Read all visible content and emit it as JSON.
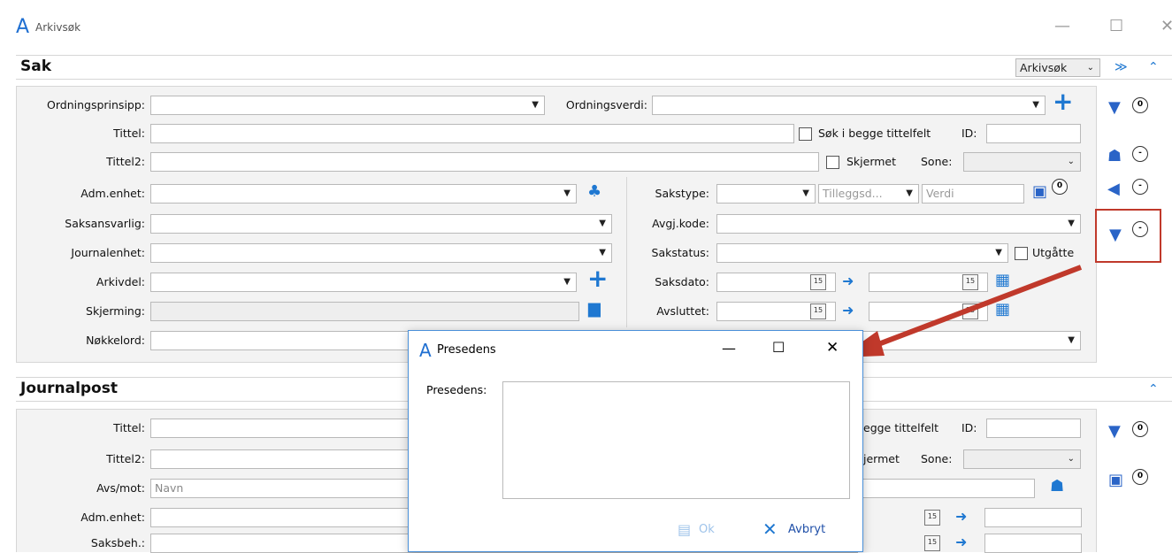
{
  "window": {
    "title": "Arkivsøk",
    "logo": "A",
    "minimize": "—",
    "maximize": "☐",
    "close": "✕"
  },
  "sak": {
    "title": "Sak",
    "search_type": "Arkivsøk",
    "collapse_all": "≫",
    "collapse": "⌃",
    "labels": {
      "ordningsprinsipp": "Ordningsprinsipp:",
      "ordningsverdi": "Ordningsverdi:",
      "tittel": "Tittel:",
      "tittel2": "Tittel2:",
      "admenhet": "Adm.enhet:",
      "saksansvarlig": "Saksansvarlig:",
      "journalenhet": "Journalenhet:",
      "arkivdel": "Arkivdel:",
      "skjerming": "Skjerming:",
      "nokkelord": "Nøkkelord:",
      "sakstype": "Sakstype:",
      "avgjkode": "Avgj.kode:",
      "sakstatus": "Sakstatus:",
      "saksdato": "Saksdato:",
      "avsluttet": "Avsluttet:"
    },
    "sok_begge": "Søk i begge tittelfelt",
    "id_label": "ID:",
    "skjermet": "Skjermet",
    "sone_label": "Sone:",
    "utgatte": "Utgåtte",
    "tilleggsdata_placeholder": "Tilleggsd...",
    "verdi_placeholder": "Verdi",
    "counts": [
      "0",
      "-",
      "-",
      "-"
    ],
    "sakstype_count": "0"
  },
  "journalpost": {
    "title": "Journalpost",
    "collapse": "⌃",
    "labels": {
      "tittel": "Tittel:",
      "tittel2": "Tittel2:",
      "avsmot": "Avs/mot:",
      "admenhet": "Adm.enhet:",
      "saksbeh": "Saksbeh.:"
    },
    "avsmot_placeholder": "Navn",
    "sok_begge": "egge tittelfelt",
    "id_label": "ID:",
    "skjermet": "jermet",
    "sone_label": "Sone:",
    "counts": [
      "0",
      "0"
    ]
  },
  "dialog": {
    "title": "Presedens",
    "logo": "A",
    "field_label": "Presedens:",
    "ok": "Ok",
    "cancel": "Avbryt",
    "minimize": "—",
    "maximize": "☐",
    "close": "✕"
  },
  "cal_day": "15",
  "colors": {
    "accent": "#1f78d1",
    "arrow": "#c0392b"
  }
}
